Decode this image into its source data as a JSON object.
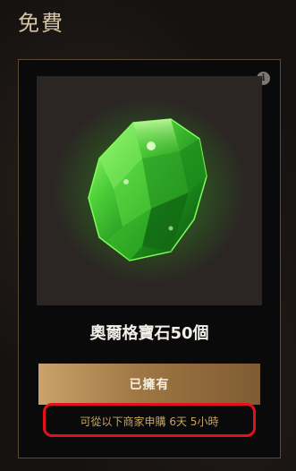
{
  "section": {
    "title": "免費"
  },
  "item": {
    "name": "奧爾格寶石50個",
    "icon": "green-gem",
    "image_background": "#2b2623"
  },
  "actions": {
    "owned_label": "已擁有"
  },
  "availability": {
    "text": "可從以下商家申購 6天 5小時"
  },
  "icons": {
    "info": "i"
  },
  "colors": {
    "accent": "#b58b57",
    "timer": "#c9a45e",
    "highlight": "#e3121a"
  }
}
